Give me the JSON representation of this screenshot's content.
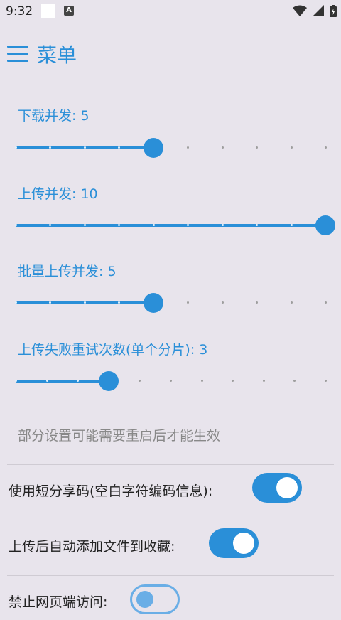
{
  "status_bar": {
    "time": "9:32",
    "a_icon": "A"
  },
  "app_bar": {
    "title": "菜单",
    "menu_icon": "hamburger-icon"
  },
  "sliders": [
    {
      "label": "下载并发: 5",
      "value": 5,
      "min": 1,
      "max": 10
    },
    {
      "label": "上传并发: 10",
      "value": 10,
      "min": 1,
      "max": 10
    },
    {
      "label": "批量上传并发: 5",
      "value": 5,
      "min": 1,
      "max": 10
    },
    {
      "label": "上传失败重试次数(单个分片): 3",
      "value": 3,
      "min": 0,
      "max": 10
    }
  ],
  "note": "部分设置可能需要重启后才能生效",
  "toggles": [
    {
      "label": "使用短分享码(空白字符编码信息):",
      "on": true
    },
    {
      "label": "上传后自动添加文件到收藏:",
      "on": true
    },
    {
      "label": "禁止网页端访问:",
      "on": false
    }
  ],
  "colors": {
    "accent": "#2a8fd8",
    "background": "#e8e4ec"
  }
}
